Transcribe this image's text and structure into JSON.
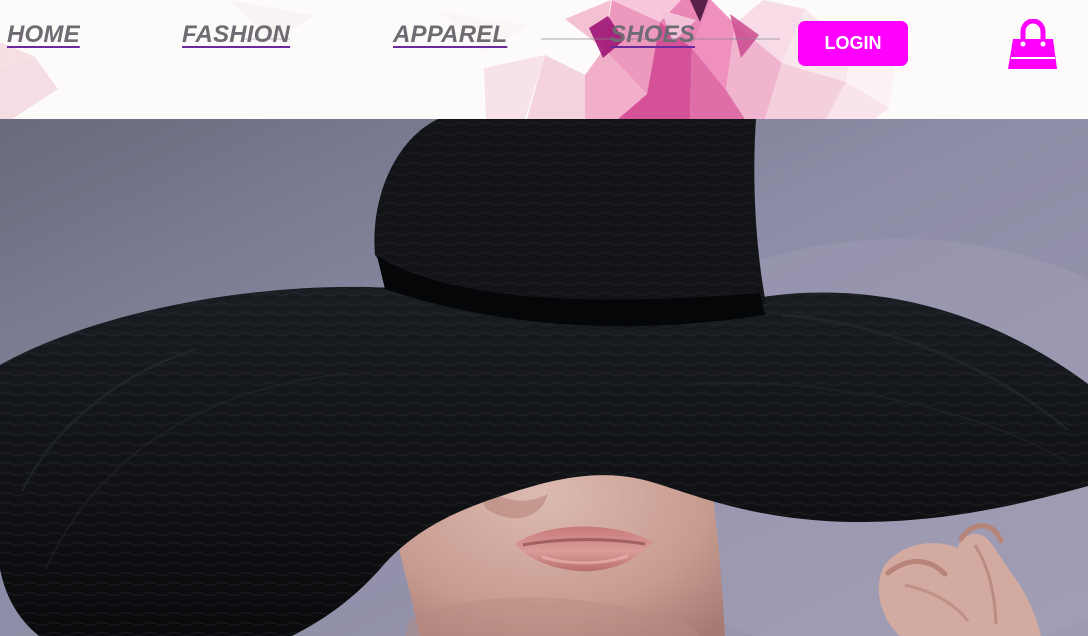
{
  "navigation": {
    "items": [
      {
        "label": "HOME"
      },
      {
        "label": "FASHION"
      },
      {
        "label": "APPAREL"
      },
      {
        "label": "SHOES"
      }
    ]
  },
  "actions": {
    "login_label": "LOGIN"
  },
  "icons": {
    "cart": "shopping-bag-icon"
  },
  "colors": {
    "accent": "#ff00ff",
    "nav_text": "#6f6b73",
    "nav_underline": "#6a2a9a",
    "header_background": "#fcfaf8"
  }
}
